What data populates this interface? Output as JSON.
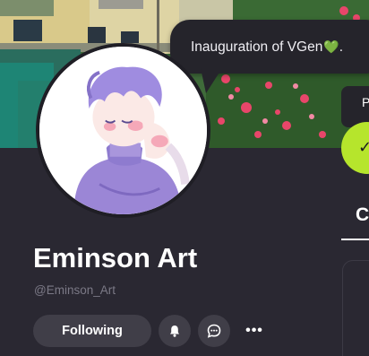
{
  "profile": {
    "display_name": "Eminson Art",
    "handle": "@Eminson_Art",
    "status_text": "Inauguration of VGen",
    "status_emoji": "💚"
  },
  "actions": {
    "follow_label": "Following",
    "bell_icon": "bell-icon",
    "message_icon": "chat-bubble-icon",
    "more_icon": "more-horizontal-icon",
    "more_glyph": "•••"
  },
  "right_panel": {
    "partial_letter": "P",
    "check_glyph": "✓",
    "tab_partial": "C"
  },
  "colors": {
    "background": "#2a2832",
    "button": "#403e48",
    "accent_green": "#b6e52c",
    "handle_text": "#7b7986"
  }
}
